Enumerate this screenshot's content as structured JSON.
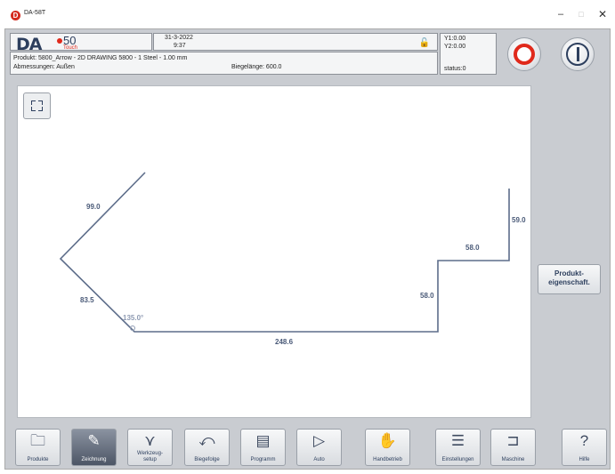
{
  "window": {
    "app_icon": "D",
    "title": "DA-58T",
    "minimize": "–",
    "maximize": "□",
    "close": "✕"
  },
  "header": {
    "logo": {
      "brand": "DA",
      "model": "50",
      "variant": "Touch"
    },
    "date": "31-3-2022",
    "time": "9:37",
    "lock_icon": "padlock-open-icon",
    "product": "Produkt: 5800_Arrow - 2D DRAWING 5800 - 1 Steel - 1.00 mm",
    "dimensions": "Abmessungen: Außen",
    "bend_length": "Biegelänge: 600.0",
    "axes": {
      "y1": "Y1:0.00",
      "y2": "Y2:0.00",
      "status": "status:0"
    },
    "stop_color": "#e0291b",
    "start_color": "#2d3f5e"
  },
  "drawing": {
    "fit_icon": "fit-to-screen-icon",
    "labels": {
      "seg_99": "99.0",
      "seg_83": "83.5",
      "angle": "135.0°",
      "seg_248": "248.6",
      "seg_58_vertical": "58.0",
      "seg_58_horizontal": "58.0",
      "seg_59": "59.0"
    },
    "line_color": "#5d6d8a"
  },
  "side": {
    "product_props_label": "Produkt-\neigenschaft."
  },
  "nav": [
    {
      "key": "produkte",
      "label": "Produkte",
      "icon": "folder-icon",
      "glyph": "🗀",
      "active": false
    },
    {
      "key": "zeichnung",
      "label": "Zeichnung",
      "icon": "drawing-pen-icon",
      "glyph": "✎",
      "active": true
    },
    {
      "key": "werkzeug",
      "label": "Werkzeug-\nsetup",
      "icon": "tool-setup-icon",
      "glyph": "⋎",
      "active": false
    },
    {
      "key": "biegefolge",
      "label": "Biegefolge",
      "icon": "bend-sequence-icon",
      "glyph": "⤺",
      "active": false
    },
    {
      "key": "programm",
      "label": "Programm",
      "icon": "program-pages-icon",
      "glyph": "▤",
      "active": false
    },
    {
      "key": "auto",
      "label": "Auto",
      "icon": "play-icon",
      "glyph": "▷",
      "active": false
    },
    {
      "key": "handbetrieb",
      "label": "Handbetrieb",
      "icon": "hand-icon",
      "glyph": "✋",
      "active": false
    },
    {
      "key": "einstellungen",
      "label": "Einstellungen",
      "icon": "settings-list-icon",
      "glyph": "☰",
      "active": false
    },
    {
      "key": "maschine",
      "label": "Maschine",
      "icon": "machine-icon",
      "glyph": "⊐",
      "active": false
    },
    {
      "key": "hilfe",
      "label": "Hilfe",
      "icon": "help-icon",
      "glyph": "?",
      "active": false
    }
  ]
}
